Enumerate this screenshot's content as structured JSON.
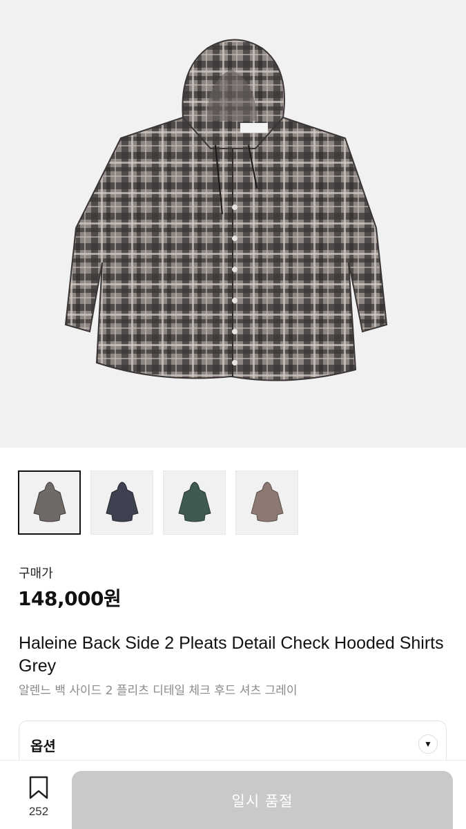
{
  "product": {
    "main_image_icon": "hooded-check-shirt-photo",
    "thumbnails": [
      {
        "name": "thumbnail-grey",
        "color": "#6f6a66",
        "selected": true
      },
      {
        "name": "thumbnail-navy",
        "color": "#3e4150",
        "selected": false
      },
      {
        "name": "thumbnail-green",
        "color": "#3f5a52",
        "selected": false
      },
      {
        "name": "thumbnail-brown",
        "color": "#8c7a72",
        "selected": false
      }
    ],
    "price_label": "구매가",
    "price": "148,000원",
    "title_en": "Haleine Back Side 2 Pleats Detail Check Hooded Shirts Grey",
    "title_ko": "알렌느 백 사이드 2 플리츠 디테일 체크 후드 셔츠 그레이"
  },
  "option": {
    "label": "옵션",
    "arrow_icon": "chevron-down-icon"
  },
  "bottom_bar": {
    "bookmark_icon": "bookmark-icon",
    "bookmark_count": "252",
    "buy_button_label": "일시 품절",
    "buy_button_color": "#c9c9c9"
  }
}
